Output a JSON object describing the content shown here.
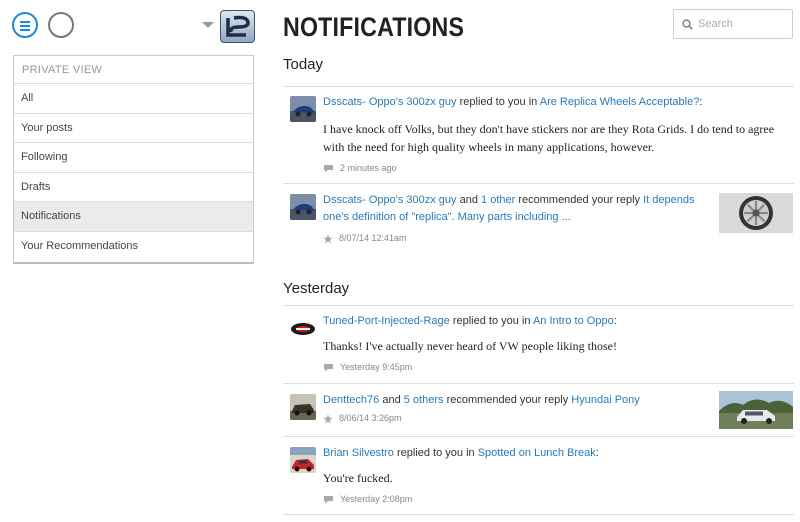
{
  "header": {
    "title": "NOTIFICATIONS"
  },
  "search": {
    "placeholder": "Search"
  },
  "sidebar": {
    "heading": "PRIVATE VIEW",
    "items": [
      {
        "label": "All",
        "active": false
      },
      {
        "label": "Your posts",
        "active": false
      },
      {
        "label": "Following",
        "active": false
      },
      {
        "label": "Drafts",
        "active": false
      },
      {
        "label": "Notifications",
        "active": true
      },
      {
        "label": "Your Recommendations",
        "active": false
      }
    ]
  },
  "sections": {
    "today": {
      "title": "Today",
      "items": [
        {
          "user": "Dsscats- Oppo's 300zx guy",
          "action": "replied to you in",
          "target": "Are Replica Wheels Acceptable?",
          "suffix": ":",
          "quote": "I have knock off Volks, but they don't have stickers nor are they Rota Grids. I do tend to agree with the need for high quality wheels in many applications, however.",
          "time": "2 minutes ago",
          "meta_icon": "speech-bubble-icon"
        },
        {
          "user": "Dsscats- Oppo's 300zx guy",
          "and": "and",
          "others": "1 other",
          "action": "recommended your reply",
          "target": "It depends one's definition of \"replica\". Many parts including ...",
          "time": "8/07/14 12:41am",
          "meta_icon": "star-icon"
        }
      ]
    },
    "yesterday": {
      "title": "Yesterday",
      "items": [
        {
          "user": "Tuned-Port-Injected-Rage",
          "action": "replied to you in",
          "target": "An Intro to Oppo",
          "suffix": ":",
          "quote": "Thanks! I've actually never heard of VW people liking those!",
          "time": "Yesterday 9:45pm",
          "meta_icon": "speech-bubble-icon"
        },
        {
          "user": "Denttech76",
          "and": "and",
          "others": "5 others",
          "action": "recommended your reply",
          "target": "Hyundai Pony",
          "time": "8/06/14 3:26pm",
          "meta_icon": "star-icon"
        },
        {
          "user": "Brian Silvestro",
          "action": "replied to you in",
          "target": "Spotted on Lunch Break",
          "suffix": ":",
          "quote": "You're fucked.",
          "time": "Yesterday 2:08pm",
          "meta_icon": "speech-bubble-icon"
        }
      ]
    }
  },
  "colors": {
    "accent": "#1a8bd0",
    "link": "#2a7ab8",
    "active_bg": "#ebebeb"
  }
}
